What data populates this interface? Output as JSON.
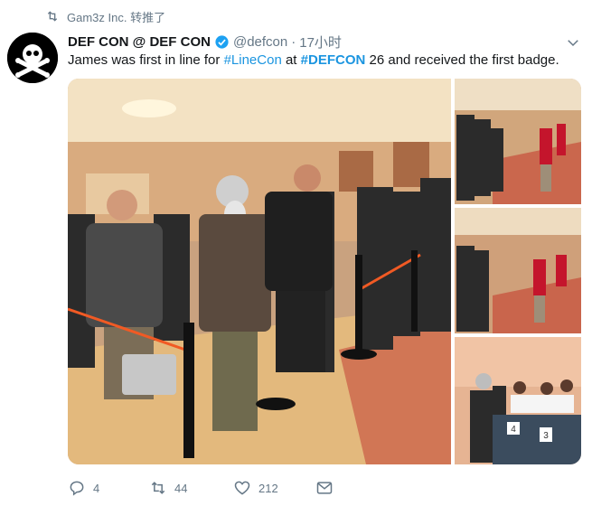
{
  "retweet_context": {
    "text": "Gam3z Inc. 转推了",
    "icon": "retweet-icon"
  },
  "author": {
    "name": "DEF CON @ DEF CON",
    "handle": "@defcon",
    "separator": "·",
    "time": "17小时",
    "avatar_icon": "skull-crossbones-icon",
    "verified_icon": "verified-badge-icon"
  },
  "tweet": {
    "text_before": "James was first in line for ",
    "hashtag1": "#LineCon",
    "text_middle": " at ",
    "hashtag2": "#DEFCON",
    "text_after": " 26 and received the first badge."
  },
  "media": {
    "photos": [
      "photo-line-queue",
      "photo-hall-1",
      "photo-hall-2",
      "photo-badge-desk"
    ],
    "desk_numbers": [
      "4",
      "3"
    ]
  },
  "actions": {
    "reply_count": "4",
    "retweet_count": "44",
    "like_count": "212"
  },
  "colors": {
    "link": "#1b95e0",
    "muted": "#657786",
    "text": "#14171a"
  }
}
